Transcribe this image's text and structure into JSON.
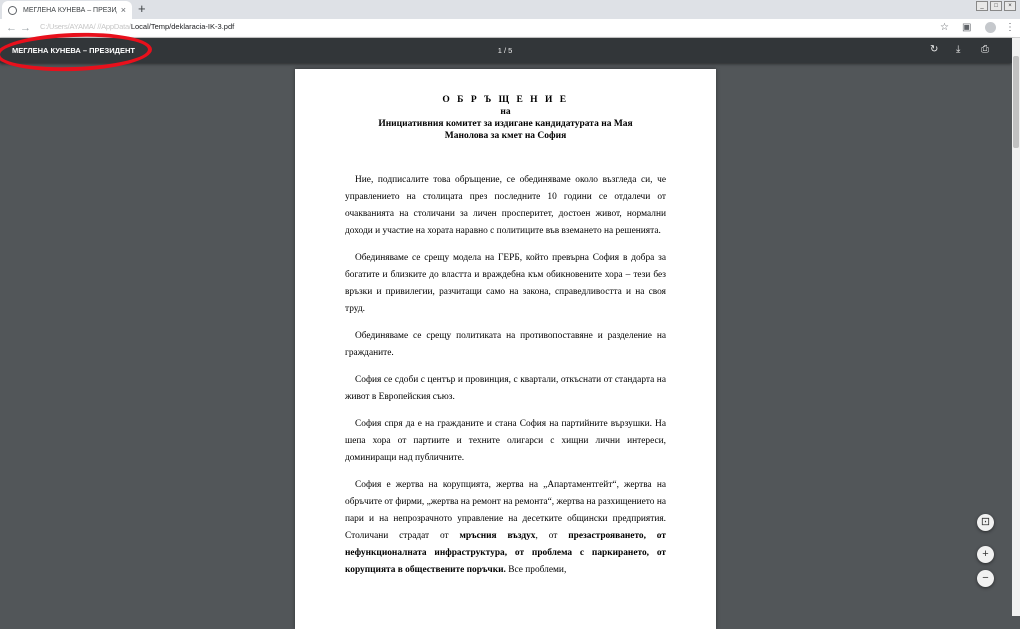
{
  "browser": {
    "tab_title": "МЕГЛЕНА КУНЕВА – ПРЕЗИДЕНТ",
    "tab_close": "×",
    "new_tab": "+",
    "back": "←",
    "forward": "→",
    "reload": "C",
    "url_hidden": "C:/Users/AYAMA/ //AppData/",
    "url_visible": "Local/Temp/deklaracia-IK-3.pdf",
    "star": "☆",
    "ext": "▣",
    "menu": "⋮"
  },
  "pdf_viewer": {
    "title": "МЕГЛЕНА КУНЕВА – ПРЕЗИДЕНТ",
    "page_count": "1 / 5",
    "rotate": "↻",
    "download": "⤓",
    "print": "⎙",
    "fit": "⊡",
    "zoom_in": "+",
    "zoom_out": "−"
  },
  "document": {
    "title": "О Б Р Ъ Щ Е Н И Е",
    "subtitle_1": "на",
    "subtitle_2": "Инициативния комитет за издигане кандидатурата на Мая",
    "subtitle_3": "Манолова за кмет на София",
    "p1": "Ние, подписалите това обръщение, се обединяваме около възгледа си, че управлението на столицата през последните 10 години се отдалечи от очакванията на столичани за личен просперитет, достоен живот, нормални доходи и участие на хората наравно с политиците във вземането на решенията.",
    "p2": "Обединяваме се срещу модела на ГЕРБ, който превърна София в добра за богатите и близките до властта и враждебна към обикновените хора – тези без връзки и привилегии, разчитащи само на закона, справедливостта и на своя труд.",
    "p3": "Обединяваме се срещу политиката на противопоставяне и разделение на гражданите.",
    "p4": "София се сдоби с център и провинция, с квартали, откъснати от стандарта на живот в Европейския съюз.",
    "p5": "София спря да е на гражданите и стана София на партийните вързушки. На шепа хора от партиите и техните олигарси с хищни лични интереси, доминиращи над публичните.",
    "p6_a": "София е жертва на корупцията, жертва на „Апартаментгейт“, жертва на обръчите от фирми, „жертва на ремонт на ремонта“, жертва на разхищението на пари и на непрозрачното управление на десетките общински предприятия. Столичани страдат от ",
    "p6_b": "мръсния въздух",
    "p6_c": ", от ",
    "p6_d": "презастрояването, от нефункционалната инфраструктура, от проблема с паркирането, от корупцията в обществените поръчки.",
    "p6_e": " Все проблеми,"
  }
}
